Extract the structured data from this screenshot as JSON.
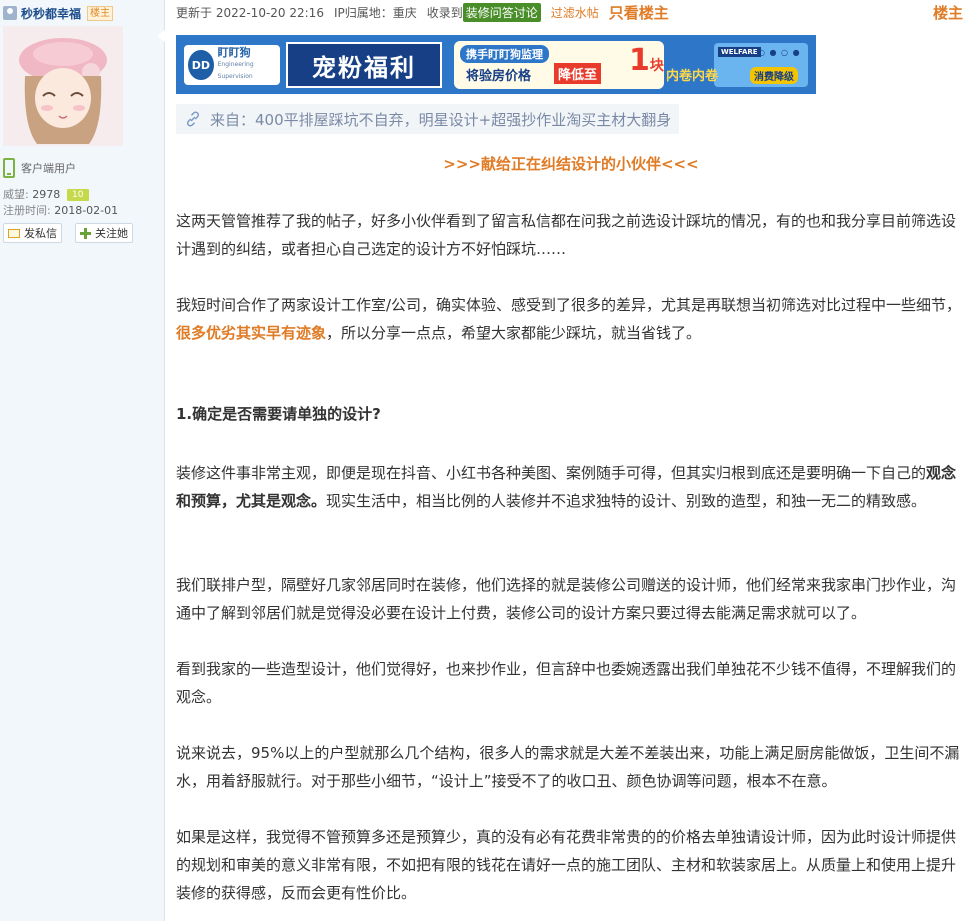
{
  "user": {
    "name": "秒秒都幸福",
    "badge": "楼主",
    "client_label": "客户端用户",
    "prestige_label": "威望:",
    "prestige_value": "2978",
    "level": "10",
    "reg_label": "注册时间:",
    "reg_value": "2018-02-01",
    "message_button": "发私信",
    "follow_button": "关注她"
  },
  "meta": {
    "updated": "更新于 2022-10-20 22:16",
    "ip": "IP归属地：重庆",
    "collected": "收录到",
    "collection_tag": "装修问答讨论",
    "filter": "过滤水帖",
    "only_op": "只看楼主",
    "floor": "楼主"
  },
  "banner": {
    "logo_mark": "DD",
    "logo_name": "盯盯狗",
    "logo_sub": "Engineering Supervision",
    "title": "宠粉福利",
    "panel_top": "携手盯盯狗监理",
    "panel_bottom": "将验房价格",
    "drop": "降低至",
    "one": "1",
    "unit": "块",
    "welfare": "WELFARE",
    "dots": "○ ● ○ ●",
    "slogan": "内卷内卷",
    "badge": "消费降级"
  },
  "source": {
    "icon": "link-icon",
    "text": "来自：400平排屋踩坑不自弃，明星设计+超强抄作业淘买主材大翻身"
  },
  "article": {
    "center_title": ">>>献给正在纠结设计的小伙伴<<<",
    "p1": "这两天管管推荐了我的帖子，好多小伙伴看到了留言私信都在问我之前选设计踩坑的情况，有的也和我分享目前筛选设计遇到的纠结，或者担心自己选定的设计方不好怕踩坑……",
    "p2_a": "我短时间合作了两家设计工作室/公司，确实体验、感受到了很多的差异，尤其是再联想当初筛选对比过程中一些细节，",
    "p2_b": "很多优劣其实早有迹象",
    "p2_c": "，所以分享一点点，希望大家都能少踩坑，就当省钱了。",
    "heading": "1.确定是否需要请单独的设计?",
    "p3_a": "装修这件事非常主观，即便是现在抖音、小红书各种美图、案例随手可得，但其实归根到底还是要明确一下自己的",
    "p3_b": "观念和预算，尤其是观念。",
    "p3_c": "现实生活中，相当比例的人装修并不追求独特的设计、别致的造型，和独一无二的精致感。",
    "p4": "我们联排户型，隔壁好几家邻居同时在装修，他们选择的就是装修公司赠送的设计师，他们经常来我家串门抄作业，沟通中了解到邻居们就是觉得没必要在设计上付费，装修公司的设计方案只要过得去能满足需求就可以了。",
    "p5": "看到我家的一些造型设计，他们觉得好，也来抄作业，但言辞中也委婉透露出我们单独花不少钱不值得，不理解我们的观念。",
    "p6": "说来说去，95%以上的户型就那么几个结构，很多人的需求就是大差不差装出来，功能上满足厨房能做饭，卫生间不漏水，用着舒服就行。对于那些小细节，“设计上”接受不了的收口丑、颜色协调等问题，根本不在意。",
    "p7": "如果是这样，我觉得不管预算多还是预算少，真的没有必有花费非常贵的的价格去单独请设计师，因为此时设计师提供的规划和审美的意义非常有限，不如把有限的钱花在请好一点的施工团队、主材和软装家居上。从质量上和使用上提升装修的获得感，反而会更有性价比。"
  }
}
